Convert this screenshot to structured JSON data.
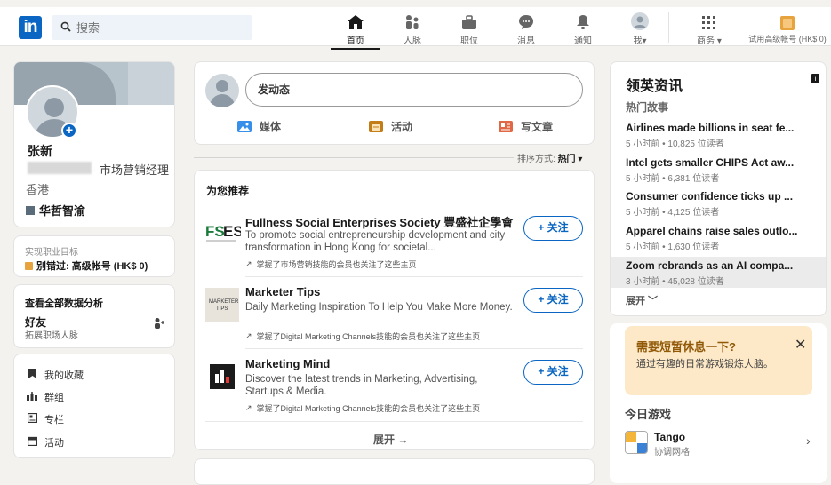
{
  "nav": {
    "search_placeholder": "搜索",
    "items": [
      {
        "label": "首页",
        "icon": "home-icon"
      },
      {
        "label": "人脉",
        "icon": "network-icon"
      },
      {
        "label": "职位",
        "icon": "jobs-icon"
      },
      {
        "label": "消息",
        "icon": "messaging-icon"
      },
      {
        "label": "通知",
        "icon": "notifications-icon"
      },
      {
        "label": "我▾",
        "icon": "me-avatar"
      },
      {
        "label": "商务 ▾",
        "icon": "grid-icon"
      },
      {
        "label": "试用高级帐号 (HK$ 0)",
        "icon": "premium-icon"
      }
    ],
    "brand_color": "#0a66c2"
  },
  "profile": {
    "name": "张新",
    "headline": "- 市场营销经理",
    "location": "香港",
    "company": "华哲智渝"
  },
  "goal": {
    "subtitle": "实现职业目标",
    "main": "别错过: 高级帐号 (HK$ 0)"
  },
  "analytics": {
    "title": "查看全部数据分析",
    "friends": "好友",
    "friends_sub": "拓展职场人脉"
  },
  "links": [
    {
      "label": "我的收藏",
      "icon": "bookmark-icon"
    },
    {
      "label": "群组",
      "icon": "groups-icon"
    },
    {
      "label": "专栏",
      "icon": "newsletter-icon"
    },
    {
      "label": "活动",
      "icon": "calendar-icon"
    }
  ],
  "post": {
    "placeholder": "发动态",
    "actions": [
      {
        "label": "媒体",
        "icon": "media-icon"
      },
      {
        "label": "活动",
        "icon": "event-icon"
      },
      {
        "label": "写文章",
        "icon": "article-icon"
      }
    ]
  },
  "sort": {
    "prefix": "排序方式:",
    "value": "热门 ▾"
  },
  "recommend": {
    "title": "为您推荐",
    "follow_label": "+ 关注",
    "items": [
      {
        "name": "Fullness Social Enterprises Society 豐盛社企學會",
        "desc": "To promote social entrepreneurship development and city transformation in Hong Kong for societal...",
        "note": "掌握了市场营销技能的会员也关注了这些主页",
        "logo_text": "FSES"
      },
      {
        "name": "Marketer Tips",
        "desc": "Daily Marketing Inspiration To Help You Make More Money.",
        "note": "掌握了Digital Marketing Channels技能的会员也关注了这些主页",
        "logo_text": "MARKETER TIPS"
      },
      {
        "name": "Marketing Mind",
        "desc": "Discover the latest trends in Marketing, Advertising, Startups & Media.",
        "note": "掌握了Digital Marketing Channels技能的会员也关注了这些主页",
        "logo_text": ""
      }
    ],
    "show_more": "展开 →"
  },
  "news": {
    "title": "领英资讯",
    "subtitle": "热门故事",
    "items": [
      {
        "headline": "Airlines made billions in seat fe...",
        "meta": "5 小时前 • 10,825 位读者"
      },
      {
        "headline": "Intel gets smaller CHIPS Act aw...",
        "meta": "5 小时前 • 6,381 位读者"
      },
      {
        "headline": "Consumer confidence ticks up ...",
        "meta": "5 小时前 • 4,125 位读者"
      },
      {
        "headline": "Apparel chains raise sales outlo...",
        "meta": "5 小时前 • 1,630 位读者"
      },
      {
        "headline": "Zoom rebrands as an AI compa...",
        "meta": "3 小时前 • 45,028 位读者"
      }
    ],
    "expand": "展开 ﹀"
  },
  "games": {
    "break_title": "需要短暂休息一下?",
    "break_desc": "通过有趣的日常游戏锻炼大脑。",
    "today": "今日游戏",
    "tango_name": "Tango",
    "tango_sub": "协调网格"
  }
}
